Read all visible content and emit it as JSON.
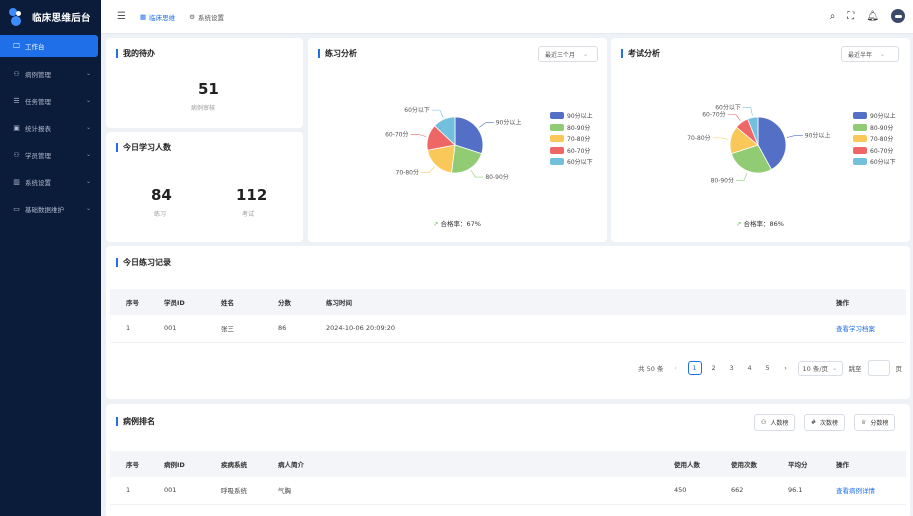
{
  "app": {
    "title": "临床思维后台"
  },
  "sidebar": {
    "items": [
      {
        "label": "工作台",
        "icon": "monitor-icon",
        "glyph": "🖵",
        "active": true,
        "expandable": false
      },
      {
        "label": "病例管理",
        "icon": "user-icon",
        "glyph": "⚇",
        "expandable": true
      },
      {
        "label": "任务管理",
        "icon": "list-icon",
        "glyph": "☰",
        "expandable": true
      },
      {
        "label": "统计报表",
        "icon": "chart-icon",
        "glyph": "▣",
        "expandable": true
      },
      {
        "label": "学员管理",
        "icon": "person-icon",
        "glyph": "⚇",
        "expandable": true
      },
      {
        "label": "系统设置",
        "icon": "building-icon",
        "glyph": "▥",
        "expandable": true
      },
      {
        "label": "基础数据维护",
        "icon": "folder-icon",
        "glyph": "▭",
        "expandable": true
      }
    ]
  },
  "topbar": {
    "tabs": [
      {
        "label": "临床思维",
        "icon": "table-icon",
        "glyph": "▦"
      },
      {
        "label": "系统设置",
        "icon": "gear-icon",
        "glyph": "⚙"
      }
    ]
  },
  "todo": {
    "title": "我的待办",
    "count": "51",
    "count_label": "病例审核"
  },
  "today_learners": {
    "title": "今日学习人数",
    "practice_count": "84",
    "practice_label": "练习",
    "exam_count": "112",
    "exam_label": "考试"
  },
  "practice_analysis": {
    "title": "练习分析",
    "period": "最近三个月",
    "pass_rate": "合格率：67%"
  },
  "exam_analysis": {
    "title": "考试分析",
    "period": "最近半年",
    "pass_rate": "合格率：86%"
  },
  "chart_data": [
    {
      "type": "pie",
      "title": "练习分析",
      "labels": [
        "90分以上",
        "80-90分",
        "70-80分",
        "60-70分",
        "60分以下"
      ],
      "values": [
        30,
        22,
        20,
        15,
        13
      ],
      "colors": [
        "#5470c6",
        "#91cc75",
        "#fac858",
        "#ee6666",
        "#73c0de"
      ],
      "legend": "right"
    },
    {
      "type": "pie",
      "title": "考试分析",
      "labels": [
        "90分以上",
        "80-90分",
        "70-80分",
        "60-70分",
        "60分以下"
      ],
      "values": [
        42,
        28,
        16,
        8,
        6
      ],
      "colors": [
        "#5470c6",
        "#91cc75",
        "#fac858",
        "#ee6666",
        "#73c0de"
      ],
      "legend": "right"
    }
  ],
  "records": {
    "title": "今日练习记录",
    "columns": [
      "序号",
      "学员ID",
      "姓名",
      "分数",
      "练习时间",
      "操作"
    ],
    "rows": [
      {
        "idx": "1",
        "id": "001",
        "name": "张三",
        "score": "86",
        "time": "2024-10-06 20:09:20",
        "action": "查看学习档案"
      }
    ],
    "pager": {
      "total": "共 50 条",
      "prev": "‹",
      "pages": [
        "1",
        "2",
        "3",
        "4",
        "5"
      ],
      "next": "›",
      "page_size": "10 条/页",
      "goto": "跳至",
      "page_unit": "页"
    }
  },
  "ranking": {
    "title": "病例排名",
    "buttons": [
      {
        "label": "人数榜",
        "icon": "people-icon",
        "glyph": "⚇"
      },
      {
        "label": "次数榜",
        "icon": "hash-icon",
        "glyph": "#"
      },
      {
        "label": "分数榜",
        "icon": "trophy-icon",
        "glyph": "♕"
      }
    ],
    "columns": [
      "序号",
      "病例ID",
      "疾病系统",
      "病人简介",
      "使用人数",
      "使用次数",
      "平均分",
      "操作"
    ],
    "rows": [
      {
        "idx": "1",
        "id": "001",
        "system": "呼吸系统",
        "intro": "气胸",
        "users": "450",
        "uses": "662",
        "avg": "96.1",
        "action": "查看病例详情"
      }
    ]
  }
}
